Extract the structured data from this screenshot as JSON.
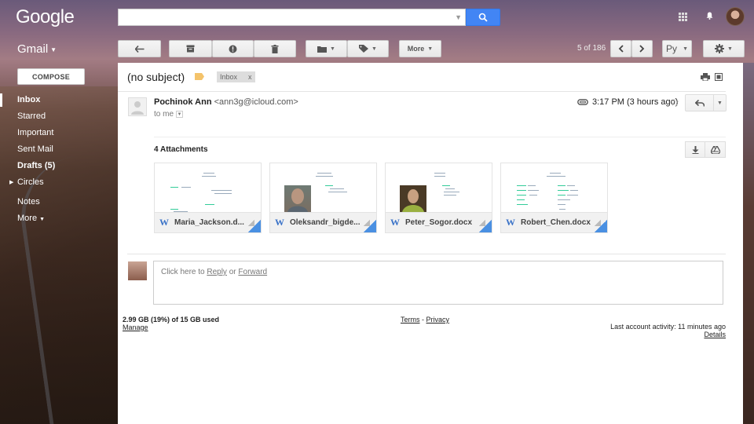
{
  "header": {
    "logo": "Google",
    "search_placeholder": "",
    "product": "Gmail"
  },
  "toolbar": {
    "more_label": "More",
    "pager": "5 of 186",
    "lang": "Ру"
  },
  "sidebar": {
    "compose_label": "COMPOSE",
    "items": [
      {
        "label": "Inbox"
      },
      {
        "label": "Starred"
      },
      {
        "label": "Important"
      },
      {
        "label": "Sent Mail"
      },
      {
        "label": "Drafts (5)"
      },
      {
        "label": "Circles"
      },
      {
        "label": "Notes"
      },
      {
        "label": "More"
      }
    ]
  },
  "message": {
    "subject": "(no subject)",
    "label_chip": "Inbox",
    "label_chip_close": "x",
    "sender_name": "Pochinok Ann",
    "sender_email": "<ann3g@icloud.com>",
    "to": "to me",
    "time": "3:17 PM (3 hours ago)",
    "attachments_title": "4 Attachments",
    "attachments": [
      {
        "name": "Maria_Jackson.d..."
      },
      {
        "name": "Oleksandr_bigde..."
      },
      {
        "name": "Peter_Sogor.docx"
      },
      {
        "name": "Robert_Chen.docx"
      }
    ],
    "reply_prompt": "Click here to",
    "reply_link": "Reply",
    "or_text": "or",
    "forward_link": "Forward"
  },
  "footer": {
    "storage": "2.99 GB (19%) of 15 GB used",
    "manage": "Manage",
    "terms": "Terms",
    "sep": "-",
    "privacy": "Privacy",
    "activity": "Last account activity: 11 minutes ago",
    "details": "Details"
  },
  "colors": {
    "search_button": "#4285f4",
    "label_tag": "#f4c36b",
    "word_icon": "#3b73c8"
  }
}
